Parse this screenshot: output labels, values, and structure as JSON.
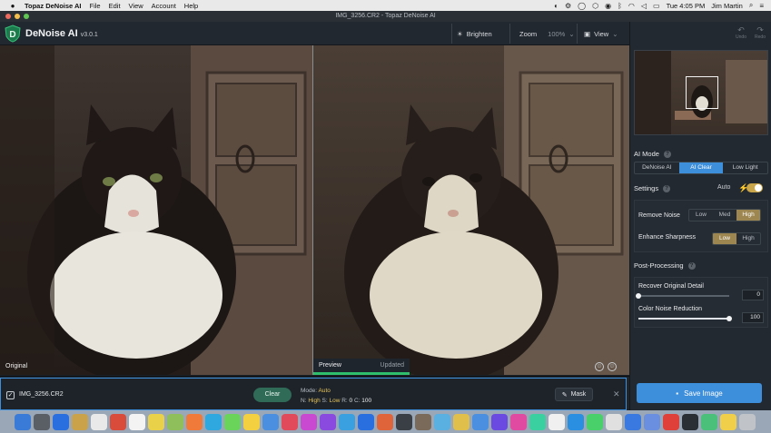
{
  "menubar": {
    "app_name": "Topaz DeNoise AI",
    "items": [
      "File",
      "Edit",
      "View",
      "Account",
      "Help"
    ],
    "clock": "Tue 4:05 PM",
    "user": "Jim Martin"
  },
  "window": {
    "title": "IMG_3256.CR2 - Topaz DeNoise AI"
  },
  "toolbar": {
    "app_title": "DeNoise AI",
    "version": "v3.0.1",
    "brighten_label": "Brighten",
    "zoom_label": "Zoom",
    "zoom_value": "100%",
    "view_label": "View"
  },
  "image": {
    "original_label": "Original",
    "preview_label": "Preview",
    "preview_status": "Updated"
  },
  "bottom": {
    "filename": "IMG_3256.CR2",
    "clear_label": "Clear",
    "mode_label": "Mode:",
    "mode_value": "Auto",
    "n_label": "N:",
    "n_value": "High",
    "s_label": "S:",
    "s_value": "Low",
    "r_label": "R:",
    "r_value": "0",
    "c_label": "C:",
    "c_value": "100",
    "mask_label": "Mask"
  },
  "sidebar": {
    "undo_label": "Undo",
    "redo_label": "Redo",
    "ai_mode_title": "AI Mode",
    "ai_modes": [
      "DeNoise AI",
      "AI Clear",
      "Low Light"
    ],
    "ai_mode_selected": "AI Clear",
    "settings_title": "Settings",
    "auto_label": "Auto",
    "remove_noise_label": "Remove Noise",
    "remove_noise_options": [
      "Low",
      "Med",
      "High"
    ],
    "remove_noise_selected": "High",
    "enhance_sharpness_label": "Enhance Sharpness",
    "enhance_sharpness_options": [
      "Low",
      "High"
    ],
    "enhance_sharpness_selected": "Low",
    "post_processing_title": "Post-Processing",
    "recover_label": "Recover Original Detail",
    "recover_value": "0",
    "recover_level": 0,
    "color_noise_label": "Color Noise Reduction",
    "color_noise_value": "100",
    "color_noise_level": 1,
    "save_label": "Save Image"
  },
  "colors": {
    "accent": "#3d8edb",
    "gold": "#c9a64a",
    "green": "#2fbf6c",
    "panel": "#232930"
  }
}
